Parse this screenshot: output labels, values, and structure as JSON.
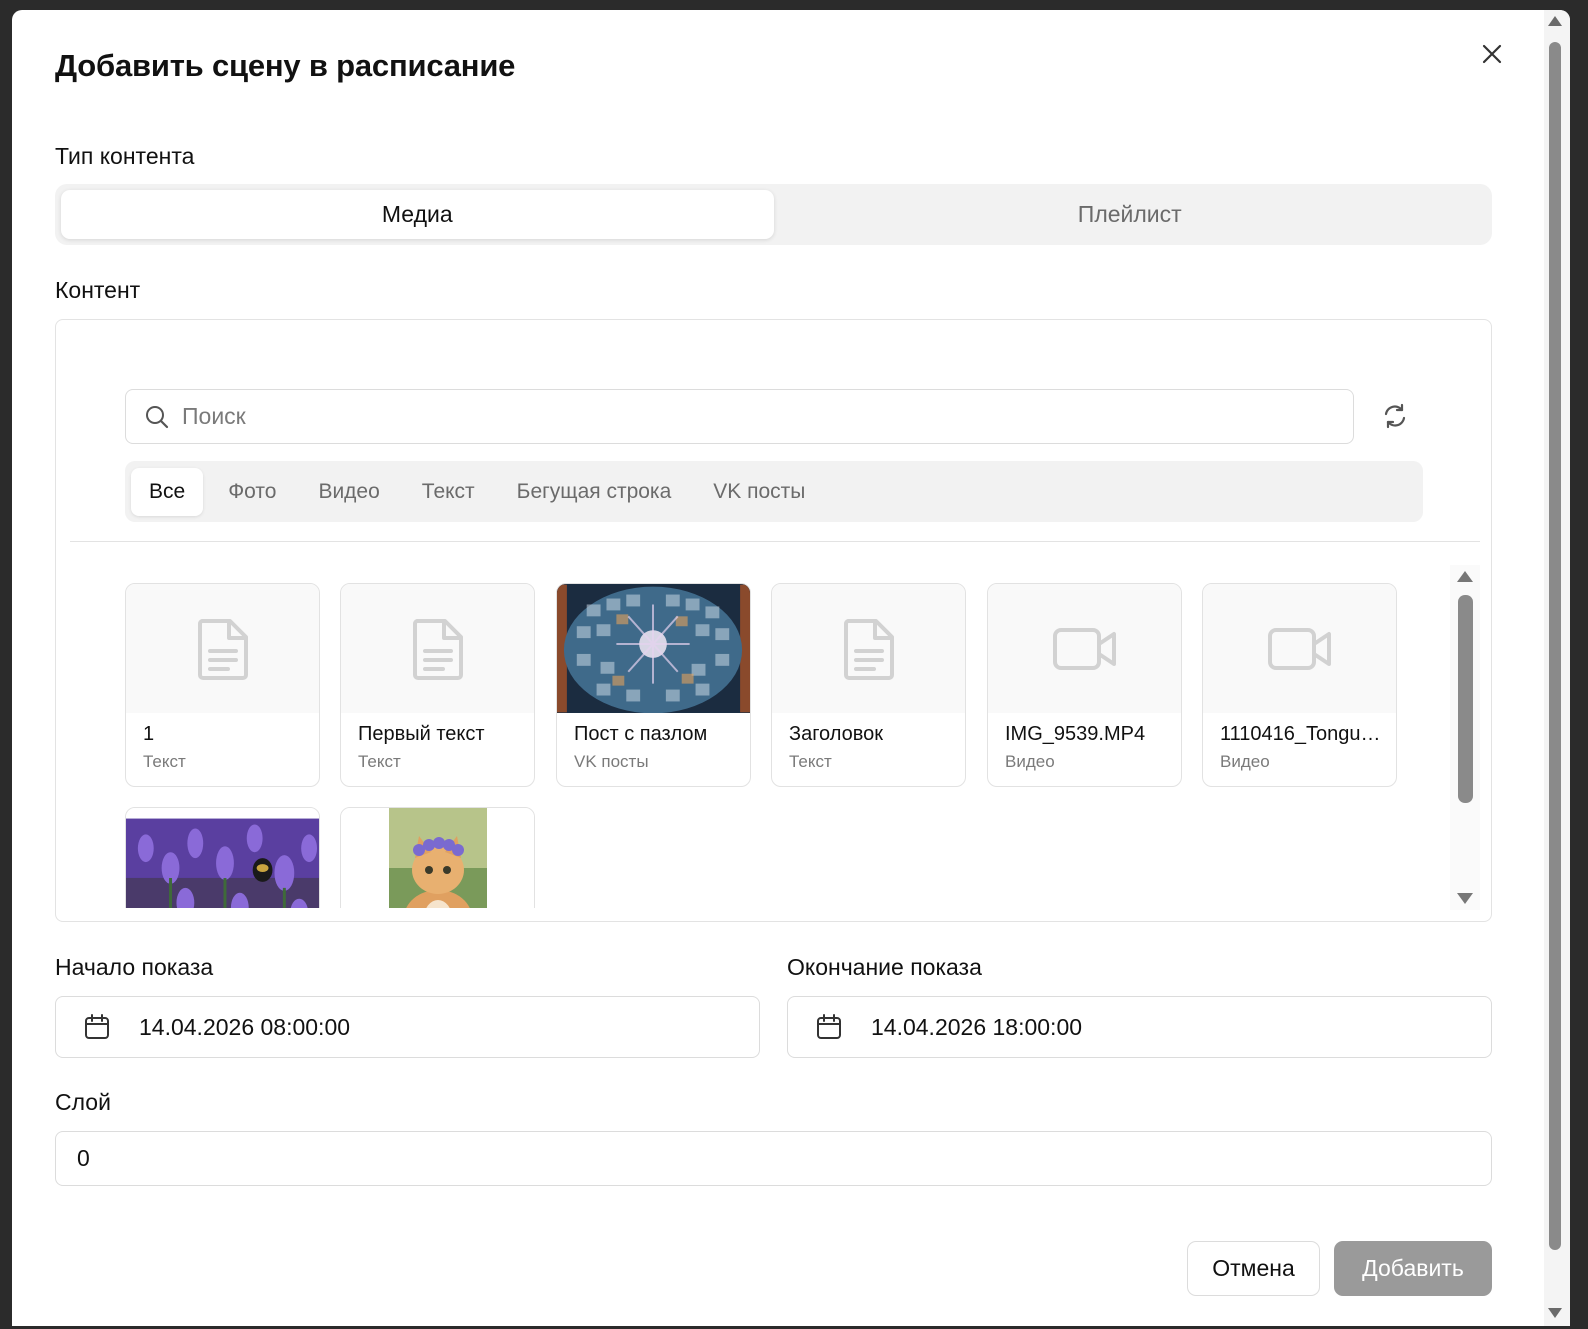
{
  "dialog": {
    "title": "Добавить сцену в расписание",
    "close_label": "close"
  },
  "content_type": {
    "label": "Тип контента",
    "options": [
      {
        "label": "Медиа",
        "active": true
      },
      {
        "label": "Плейлист",
        "active": false
      }
    ]
  },
  "content": {
    "label": "Контент",
    "search": {
      "placeholder": "Поиск",
      "value": ""
    },
    "filters": [
      {
        "label": "Все",
        "active": true
      },
      {
        "label": "Фото",
        "active": false
      },
      {
        "label": "Видео",
        "active": false
      },
      {
        "label": "Текст",
        "active": false
      },
      {
        "label": "Бегущая строка",
        "active": false
      },
      {
        "label": "VK посты",
        "active": false
      }
    ],
    "items": [
      {
        "name": "1",
        "kind": "Текст",
        "icon": "document-icon"
      },
      {
        "name": "Первый текст",
        "kind": "Текст",
        "icon": "document-icon"
      },
      {
        "name": "Пост с пазлом",
        "kind": "VK посты",
        "icon": "image-thumbnail"
      },
      {
        "name": "Заголовок",
        "kind": "Текст",
        "icon": "document-icon"
      },
      {
        "name": "IMG_9539.MP4",
        "kind": "Видео",
        "icon": "video-camera-icon"
      },
      {
        "name": "1110416_Tongue...",
        "kind": "Видео",
        "icon": "video-camera-icon"
      },
      {
        "name": "",
        "kind": "",
        "icon": "image-thumbnail"
      },
      {
        "name": "",
        "kind": "",
        "icon": "image-thumbnail"
      }
    ]
  },
  "schedule": {
    "start_label": "Начало показа",
    "start_value": "14.04.2026 08:00:00",
    "end_label": "Окончание показа",
    "end_value": "14.04.2026 18:00:00"
  },
  "layer": {
    "label": "Слой",
    "value": "0"
  },
  "footer": {
    "cancel_label": "Отмена",
    "submit_label": "Добавить"
  },
  "colors": {
    "submit_disabled": "#9a9a9a",
    "segment_bg": "#f2f2f2"
  }
}
